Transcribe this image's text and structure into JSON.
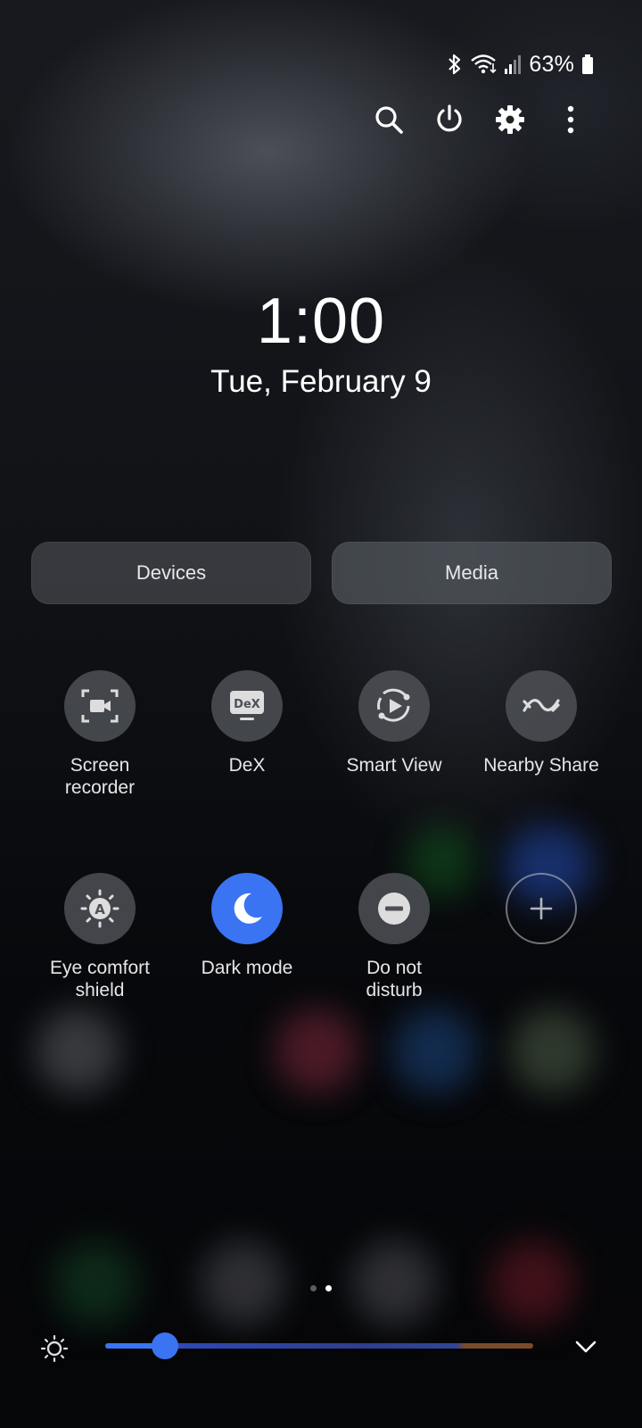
{
  "status_bar": {
    "battery_text": "63%",
    "icons": [
      "bluetooth-icon",
      "wifi-icon",
      "signal-icon",
      "battery-icon"
    ]
  },
  "actions": [
    "search-icon",
    "power-icon",
    "gear-icon",
    "more-vert-icon"
  ],
  "clock": {
    "time": "1:00",
    "date": "Tue, February 9"
  },
  "buttons": {
    "devices": "Devices",
    "media": "Media"
  },
  "tiles": [
    {
      "label": "Screen recorder",
      "icon": "screen-recorder-icon",
      "active": false
    },
    {
      "label": "DeX",
      "icon": "dex-icon",
      "active": false
    },
    {
      "label": "Smart View",
      "icon": "smart-view-icon",
      "active": false
    },
    {
      "label": "Nearby Share",
      "icon": "nearby-share-icon",
      "active": false
    },
    {
      "label": "Eye comfort shield",
      "icon": "eye-comfort-icon",
      "active": false
    },
    {
      "label": "Dark mode",
      "icon": "moon-icon",
      "active": true
    },
    {
      "label": "Do not disturb",
      "icon": "do-not-disturb-icon",
      "active": false
    },
    {
      "label": "",
      "icon": "add-icon",
      "active": false
    }
  ],
  "pager": {
    "pages": 2,
    "current": 2
  },
  "brightness": {
    "level": 0.14
  },
  "colors": {
    "accent": "#3a74f2",
    "tile": "#4e5056",
    "text": "#ffffff"
  }
}
